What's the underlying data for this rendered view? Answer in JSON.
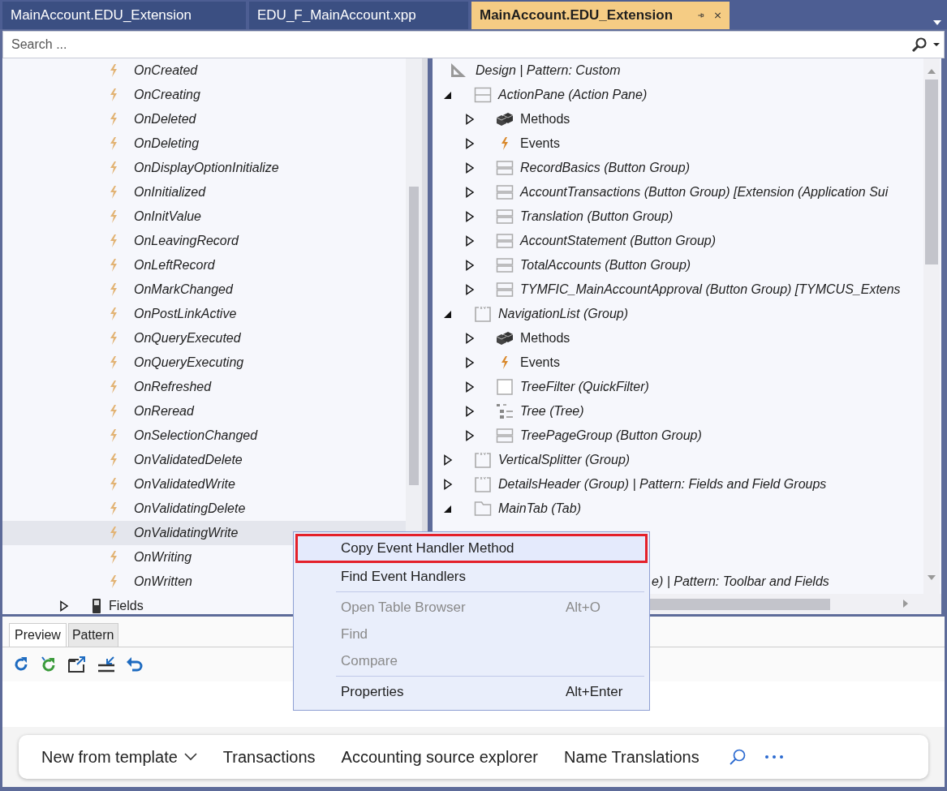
{
  "tabs": [
    {
      "label": "MainAccount.EDU_Extension",
      "selected": false
    },
    {
      "label": "EDU_F_MainAccount.xpp",
      "selected": false
    },
    {
      "label": "MainAccount.EDU_Extension",
      "selected": true
    }
  ],
  "search": {
    "placeholder": "Search ..."
  },
  "left_tree": {
    "rows": [
      {
        "kind": "event",
        "label": "OnCreated",
        "selected": false
      },
      {
        "kind": "event",
        "label": "OnCreating",
        "selected": false
      },
      {
        "kind": "event",
        "label": "OnDeleted",
        "selected": false
      },
      {
        "kind": "event",
        "label": "OnDeleting",
        "selected": false
      },
      {
        "kind": "event",
        "label": "OnDisplayOptionInitialize",
        "selected": false
      },
      {
        "kind": "event",
        "label": "OnInitialized",
        "selected": false
      },
      {
        "kind": "event",
        "label": "OnInitValue",
        "selected": false
      },
      {
        "kind": "event",
        "label": "OnLeavingRecord",
        "selected": false
      },
      {
        "kind": "event",
        "label": "OnLeftRecord",
        "selected": false
      },
      {
        "kind": "event",
        "label": "OnMarkChanged",
        "selected": false
      },
      {
        "kind": "event",
        "label": "OnPostLinkActive",
        "selected": false
      },
      {
        "kind": "event",
        "label": "OnQueryExecuted",
        "selected": false
      },
      {
        "kind": "event",
        "label": "OnQueryExecuting",
        "selected": false
      },
      {
        "kind": "event",
        "label": "OnRefreshed",
        "selected": false
      },
      {
        "kind": "event",
        "label": "OnReread",
        "selected": false
      },
      {
        "kind": "event",
        "label": "OnSelectionChanged",
        "selected": false
      },
      {
        "kind": "event",
        "label": "OnValidatedDelete",
        "selected": false
      },
      {
        "kind": "event",
        "label": "OnValidatedWrite",
        "selected": false
      },
      {
        "kind": "event",
        "label": "OnValidatingDelete",
        "selected": false
      },
      {
        "kind": "event",
        "label": "OnValidatingWrite",
        "selected": true
      },
      {
        "kind": "event",
        "label": "OnWriting",
        "selected": false
      },
      {
        "kind": "event",
        "label": "OnWritten",
        "selected": false
      },
      {
        "kind": "group",
        "label": "Fields",
        "selected": false,
        "expanded": false
      }
    ]
  },
  "right_tree": {
    "header": "Design | Pattern: Custom",
    "nodes": [
      {
        "kind": "action_pane",
        "label": "ActionPane (Action Pane)",
        "expanded": true,
        "children": [
          {
            "kind": "methods",
            "label": "Methods",
            "expanded": false
          },
          {
            "kind": "events",
            "label": "Events",
            "expanded": false
          },
          {
            "kind": "button_group",
            "label": "RecordBasics (Button Group)",
            "expanded": false
          },
          {
            "kind": "button_group",
            "label": "AccountTransactions (Button Group) [Extension (Application Sui",
            "expanded": false
          },
          {
            "kind": "button_group",
            "label": "Translation (Button Group)",
            "expanded": false
          },
          {
            "kind": "button_group",
            "label": "AccountStatement (Button Group)",
            "expanded": false
          },
          {
            "kind": "button_group",
            "label": "TotalAccounts (Button Group)",
            "expanded": false
          },
          {
            "kind": "button_group",
            "label": "TYMFIC_MainAccountApproval (Button Group) [TYMCUS_Extens",
            "expanded": false
          }
        ]
      },
      {
        "kind": "group",
        "label": "NavigationList (Group)",
        "expanded": true,
        "children": [
          {
            "kind": "methods",
            "label": "Methods",
            "expanded": false
          },
          {
            "kind": "events",
            "label": "Events",
            "expanded": false
          },
          {
            "kind": "quick_filter",
            "label": "TreeFilter (QuickFilter)",
            "expanded": false
          },
          {
            "kind": "tree",
            "label": "Tree (Tree)",
            "expanded": false
          },
          {
            "kind": "button_group",
            "label": "TreePageGroup (Button Group)",
            "expanded": false
          }
        ]
      },
      {
        "kind": "group",
        "label": "VerticalSplitter (Group)",
        "expanded": false
      },
      {
        "kind": "group",
        "label": "DetailsHeader (Group) | Pattern: Fields and Field Groups",
        "expanded": false
      },
      {
        "kind": "tab",
        "label": "MainTab (Tab)",
        "expanded": true
      },
      {
        "kind": "clipped",
        "label": "e) | Pattern: Toolbar and Fields"
      }
    ]
  },
  "context_menu": {
    "items": [
      {
        "label": "Copy Event Handler Method",
        "selected": true,
        "disabled": false
      },
      {
        "label": "Find Event Handlers",
        "selected": false,
        "disabled": false,
        "separator_after": true
      },
      {
        "label": "Open Table Browser",
        "shortcut": "Alt+O",
        "selected": false,
        "disabled": true
      },
      {
        "label": "Find",
        "selected": false,
        "disabled": true
      },
      {
        "label": "Compare",
        "selected": false,
        "disabled": true,
        "separator_after": true
      },
      {
        "label": "Properties",
        "shortcut": "Alt+Enter",
        "selected": false,
        "disabled": false
      }
    ]
  },
  "preview_tabs": [
    {
      "label": "Preview",
      "selected": true
    },
    {
      "label": "Pattern",
      "selected": false
    }
  ],
  "action_bar": {
    "items": [
      {
        "label": "New from template",
        "kind": "menu"
      },
      {
        "label": "Transactions",
        "kind": "plain"
      },
      {
        "label": "Accounting source explorer",
        "kind": "plain"
      },
      {
        "label": "Name Translations",
        "kind": "plain"
      }
    ]
  }
}
